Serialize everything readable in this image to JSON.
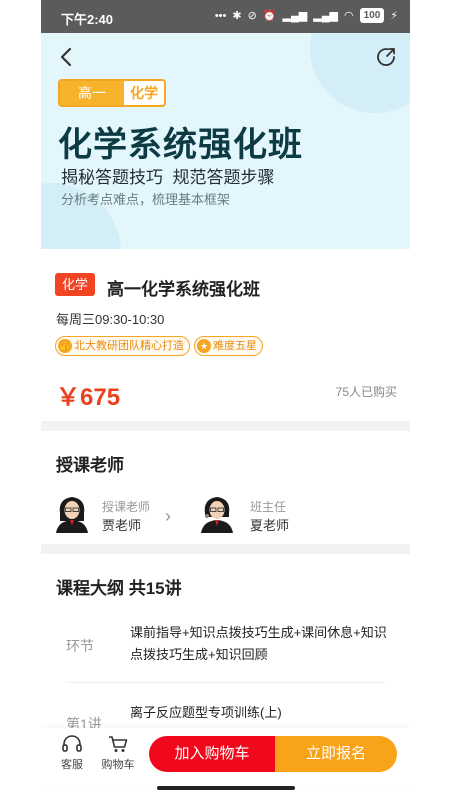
{
  "status_bar": {
    "time": "下午2:40",
    "battery": "100"
  },
  "hero": {
    "grade_tag": "高一",
    "subject_tag": "化学",
    "title": "化学系统强化班",
    "subtitle": "揭秘答题技巧  规范答题步骤",
    "description": "分析考点难点，梳理基本框架"
  },
  "course": {
    "subject_badge": "化学",
    "name": "高一化学系统强化班",
    "schedule": "每周三09:30-10:30",
    "features": [
      "北大教研团队精心打造",
      "难度五星"
    ],
    "price": "￥675",
    "bought": "75人已购买"
  },
  "teachers": {
    "section_title": "授课老师",
    "items": [
      {
        "role": "授课老师",
        "name": "贾老师"
      },
      {
        "role": "班主任",
        "name": "夏老师"
      }
    ]
  },
  "syllabus": {
    "section_title": "课程大纲  共15讲",
    "rows": [
      {
        "label": "环节",
        "text": "课前指导+知识点拨技巧生成+课间休息+知识点拨技巧生成+知识回顾"
      },
      {
        "label": "第1讲",
        "text": "离子反应题型专项训练(上)"
      }
    ]
  },
  "bottom_bar": {
    "service_label": "客服",
    "cart_label": "购物车",
    "add_to_cart": "加入购物车",
    "enroll_now": "立即报名"
  },
  "colors": {
    "accent_red": "#f04423",
    "button_red": "#f1081c",
    "button_orange": "#f9a31a",
    "hero_bg": "#e3f6fb",
    "price_red": "#e8411f"
  }
}
